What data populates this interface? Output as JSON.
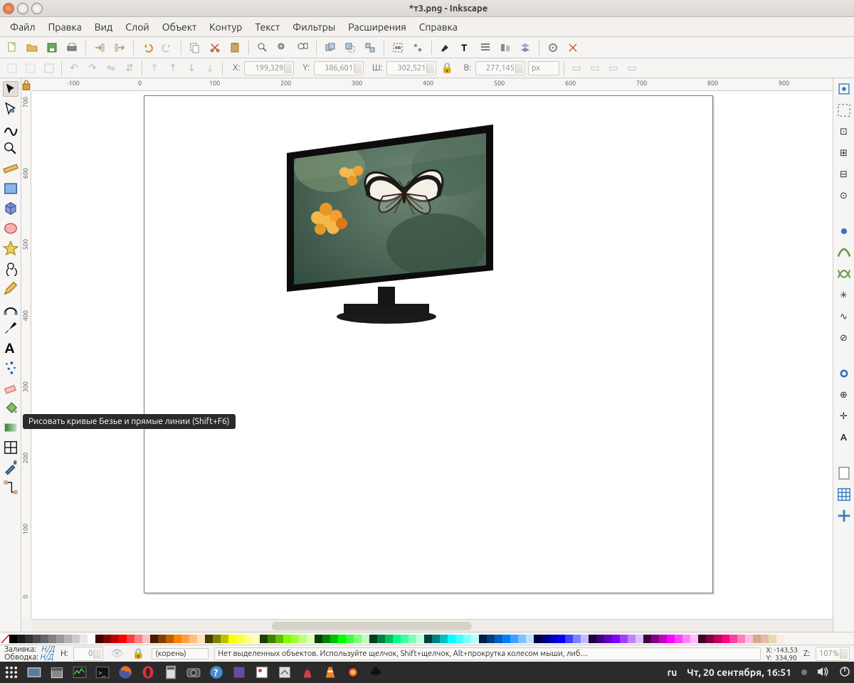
{
  "window": {
    "title": "*т3.png - Inkscape"
  },
  "menu": [
    "Файл",
    "Правка",
    "Вид",
    "Слой",
    "Объект",
    "Контур",
    "Текст",
    "Фильтры",
    "Расширения",
    "Справка"
  ],
  "coords": {
    "x_label": "X:",
    "x": "199,329",
    "y_label": "Y:",
    "y": "386,601",
    "w_label": "Ш:",
    "w": "302,521",
    "h_label": "В:",
    "h": "277,145",
    "unit": "px"
  },
  "ruler_h": [
    "-100",
    "0",
    "100",
    "200",
    "300",
    "400",
    "500",
    "600",
    "700",
    "800",
    "900"
  ],
  "ruler_v": [
    "700",
    "600",
    "500",
    "400",
    "300",
    "200",
    "100",
    "0"
  ],
  "tooltip": "Рисовать кривые Безье и прямые линии (Shift+F6)",
  "status": {
    "fill_label": "Заливка:",
    "stroke_label": "Обводка:",
    "nd": "Н/Д",
    "opacity_label": "Н:",
    "opacity": "0",
    "layer": "(корень)",
    "hint": "Нет выделенных объектов. Используйте щелчок, Shift+щелчок, Alt+прокрутка колесом мыши, либ…",
    "cx_label": "X:",
    "cx": "-143,53",
    "cy_label": "Y:",
    "cy": "334,90",
    "z_label": "Z:",
    "z": "107%"
  },
  "palette": [
    "#000000",
    "#1a1a1a",
    "#333333",
    "#4d4d4d",
    "#666666",
    "#808080",
    "#999999",
    "#b3b3b3",
    "#cccccc",
    "#e6e6e6",
    "#ffffff",
    "#400000",
    "#800000",
    "#bf0000",
    "#ff0000",
    "#ff4040",
    "#ff8080",
    "#ffbfbf",
    "#402000",
    "#804000",
    "#bf6000",
    "#ff8000",
    "#ffa040",
    "#ffc080",
    "#ffe0bf",
    "#404000",
    "#808000",
    "#bfbf00",
    "#ffff00",
    "#ffff40",
    "#ffff80",
    "#ffffbf",
    "#204000",
    "#408000",
    "#60bf00",
    "#80ff00",
    "#a0ff40",
    "#c0ff80",
    "#e0ffbf",
    "#004000",
    "#008000",
    "#00bf00",
    "#00ff00",
    "#40ff40",
    "#80ff80",
    "#bfffbf",
    "#004020",
    "#008040",
    "#00bf60",
    "#00ff80",
    "#40ffa0",
    "#80ffc0",
    "#bfffe0",
    "#004040",
    "#008080",
    "#00bfbf",
    "#00ffff",
    "#40ffff",
    "#80ffff",
    "#bfffff",
    "#002040",
    "#004080",
    "#0060bf",
    "#0080ff",
    "#40a0ff",
    "#80c0ff",
    "#bfe0ff",
    "#000040",
    "#000080",
    "#0000bf",
    "#0000ff",
    "#4040ff",
    "#8080ff",
    "#bfbfff",
    "#200040",
    "#400080",
    "#6000bf",
    "#8000ff",
    "#a040ff",
    "#c080ff",
    "#e0bfff",
    "#400040",
    "#800080",
    "#bf00bf",
    "#ff00ff",
    "#ff40ff",
    "#ff80ff",
    "#ffbfff",
    "#400020",
    "#800040",
    "#bf0060",
    "#ff0080",
    "#ff40a0",
    "#ff80c0",
    "#ffbfe0",
    "#d4aa88",
    "#e0c0a0",
    "#ecd6b8",
    "#f7eddf"
  ],
  "taskbar": {
    "lang": "ru",
    "datetime": "Чт, 20 сентября, 16:51"
  }
}
